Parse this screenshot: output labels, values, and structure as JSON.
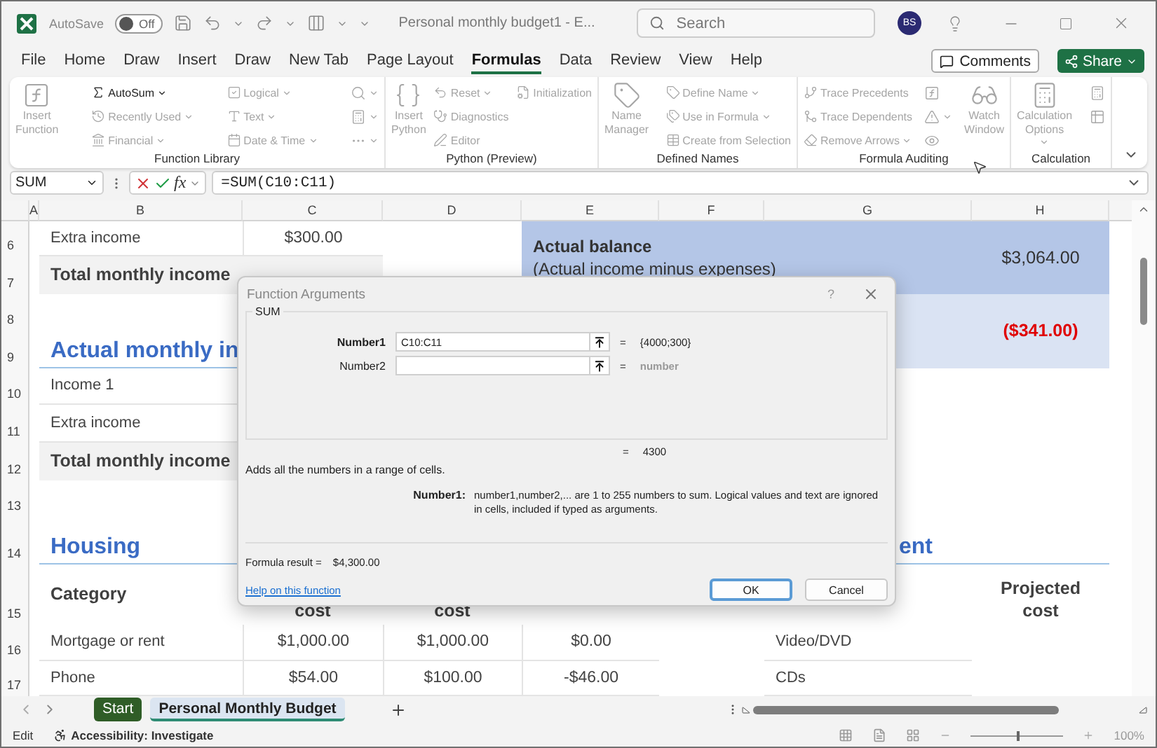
{
  "title_bar": {
    "autosave_label": "AutoSave",
    "autosave": {
      "on": false,
      "state_label": "Off"
    },
    "document_title": "Personal monthly budget1  -  E...",
    "search": {
      "placeholder": "Search"
    },
    "user_initials": "BS"
  },
  "menu_tabs": [
    {
      "label": "File",
      "selected": false
    },
    {
      "label": "Home",
      "selected": false
    },
    {
      "label": "Draw",
      "selected": false
    },
    {
      "label": "Insert",
      "selected": false
    },
    {
      "label": "Draw",
      "selected": false
    },
    {
      "label": "New Tab",
      "selected": false
    },
    {
      "label": "Page Layout",
      "selected": false
    },
    {
      "label": "Formulas",
      "selected": true
    },
    {
      "label": "Data",
      "selected": false
    },
    {
      "label": "Review",
      "selected": false
    },
    {
      "label": "View",
      "selected": false
    },
    {
      "label": "Help",
      "selected": false
    }
  ],
  "comments_button": "Comments",
  "share_button": "Share",
  "ribbon": [
    {
      "label": "Function Library",
      "columns": [
        [
          {
            "kind": "large",
            "lines": [
              "Insert",
              "Function"
            ],
            "disabled": true,
            "dropdown": false
          }
        ],
        [
          {
            "kind": "small",
            "label": "AutoSum",
            "disabled": false,
            "dropdown": true
          },
          {
            "kind": "small",
            "label": "Recently Used",
            "disabled": true,
            "dropdown": true
          },
          {
            "kind": "small",
            "label": "Financial",
            "disabled": true,
            "dropdown": true
          }
        ],
        [
          {
            "kind": "small",
            "label": "Logical",
            "disabled": true,
            "dropdown": true
          },
          {
            "kind": "small",
            "label": "Text",
            "disabled": true,
            "dropdown": true
          },
          {
            "kind": "small",
            "label": "Date & Time",
            "disabled": true,
            "dropdown": true
          }
        ],
        [
          {
            "kind": "icon",
            "disabled": true,
            "dropdown": true
          },
          {
            "kind": "icon",
            "disabled": true,
            "dropdown": true
          },
          {
            "kind": "icon",
            "disabled": true,
            "dropdown": true
          }
        ]
      ]
    },
    {
      "label": "Python (Preview)",
      "columns": [
        [
          {
            "kind": "large",
            "lines": [
              "Insert",
              "Python"
            ],
            "disabled": true,
            "dropdown": false
          }
        ],
        [
          {
            "kind": "small",
            "label": "Reset",
            "disabled": true,
            "dropdown": true
          },
          {
            "kind": "small",
            "label": "Diagnostics",
            "disabled": true,
            "dropdown": false
          },
          {
            "kind": "small",
            "label": "Editor",
            "disabled": true,
            "dropdown": false
          }
        ],
        [
          {
            "kind": "small",
            "label": "Initialization",
            "disabled": true,
            "dropdown": false
          }
        ]
      ]
    },
    {
      "label": "Defined Names",
      "columns": [
        [
          {
            "kind": "large",
            "lines": [
              "Name",
              "Manager"
            ],
            "disabled": true,
            "dropdown": false
          }
        ],
        [
          {
            "kind": "small",
            "label": "Define Name",
            "disabled": true,
            "dropdown": true
          },
          {
            "kind": "small",
            "label": "Use in Formula",
            "disabled": true,
            "dropdown": true
          },
          {
            "kind": "small",
            "label": "Create from Selection",
            "disabled": true,
            "dropdown": false
          }
        ]
      ]
    },
    {
      "label": "Formula Auditing",
      "columns": [
        [
          {
            "kind": "small",
            "label": "Trace Precedents",
            "disabled": true,
            "dropdown": false
          },
          {
            "kind": "small",
            "label": "Trace Dependents",
            "disabled": true,
            "dropdown": false
          },
          {
            "kind": "small",
            "label": "Remove Arrows",
            "disabled": true,
            "dropdown": true
          }
        ],
        [
          {
            "kind": "icon",
            "disabled": true,
            "dropdown": false
          },
          {
            "kind": "icon",
            "disabled": true,
            "dropdown": true
          },
          {
            "kind": "icon",
            "disabled": true,
            "dropdown": false
          }
        ],
        [
          {
            "kind": "large",
            "lines": [
              "Watch",
              "Window"
            ],
            "disabled": true,
            "dropdown": false
          }
        ]
      ]
    },
    {
      "label": "Calculation",
      "columns": [
        [
          {
            "kind": "large",
            "lines": [
              "Calculation",
              "Options"
            ],
            "disabled": true,
            "dropdown": true
          }
        ],
        [
          {
            "kind": "icon",
            "disabled": true,
            "dropdown": false
          },
          {
            "kind": "icon",
            "disabled": true,
            "dropdown": false
          }
        ]
      ]
    }
  ],
  "formula_bar": {
    "name_box": "SUM",
    "fx_label": "fx",
    "formula": "=SUM(C10:C11)"
  },
  "sheet": {
    "columns": [
      "A",
      "B",
      "C",
      "D",
      "E",
      "F",
      "G",
      "H"
    ],
    "rows": [
      {
        "number": "6",
        "cells": {
          "B": {
            "kind": "label",
            "text": "Extra income"
          },
          "C": {
            "kind": "money",
            "text": "$300.00"
          }
        }
      },
      {
        "number": "7",
        "cells": {
          "B": {
            "kind": "total",
            "text": "Total monthly income"
          },
          "C": {
            "kind": "total_fill"
          }
        }
      },
      {
        "number": "8"
      },
      {
        "number": "9",
        "cells": {
          "B": {
            "kind": "heading",
            "text": "Actual monthly in"
          }
        }
      },
      {
        "number": "10",
        "cells": {
          "B": {
            "kind": "label",
            "text": "Income 1"
          }
        }
      },
      {
        "number": "11",
        "cells": {
          "B": {
            "kind": "label",
            "text": "Extra income"
          }
        }
      },
      {
        "number": "12",
        "cells": {
          "B": {
            "kind": "total",
            "text": "Total monthly income"
          }
        }
      },
      {
        "number": "13"
      },
      {
        "number": "14",
        "cells": {
          "B": {
            "kind": "heading",
            "text": "Housing"
          },
          "G": {
            "kind": "heading",
            "text": "ent"
          }
        }
      },
      {
        "number": "15",
        "cells": {
          "B": {
            "kind": "category",
            "text": "Category"
          },
          "C": {
            "kind": "column_header",
            "text": "cost"
          },
          "D": {
            "kind": "column_header",
            "text": "cost"
          },
          "H": {
            "kind": "column_header",
            "text": "Projected cost"
          }
        }
      },
      {
        "number": "16",
        "cells": {
          "B": {
            "kind": "label",
            "text": "Mortgage or rent"
          },
          "C": {
            "kind": "money",
            "text": "$1,000.00"
          },
          "D": {
            "kind": "money",
            "text": "$1,000.00"
          },
          "E": {
            "kind": "money",
            "text": "$0.00"
          },
          "G": {
            "kind": "label",
            "text": "Video/DVD"
          }
        }
      },
      {
        "number": "17",
        "cells": {
          "B": {
            "kind": "label",
            "text": "Phone"
          },
          "C": {
            "kind": "money",
            "text": "$54.00"
          },
          "D": {
            "kind": "money",
            "text": "$100.00"
          },
          "E": {
            "kind": "money",
            "text": "-$46.00"
          },
          "G": {
            "kind": "label",
            "text": "CDs"
          }
        }
      }
    ],
    "balances": [
      {
        "kind": "actual",
        "title": "Actual balance",
        "subtitle": "(Actual income minus expenses)",
        "value": "$3,064.00",
        "negative": false
      },
      {
        "kind": "projected",
        "value": "($341.00)",
        "negative": true
      }
    ]
  },
  "dialog": {
    "title": "Function Arguments",
    "help_button": "?",
    "function_name": "SUM",
    "arguments": [
      {
        "label": "Number1",
        "value": "C10:C11",
        "equals": "=",
        "result": "{4000;300}",
        "active": true
      },
      {
        "label": "Number2",
        "equals": "=",
        "result": "number",
        "active": false
      }
    ],
    "total": {
      "equals": "=",
      "value": "4300"
    },
    "description": "Adds all the numbers in a range of cells.",
    "argument_help": {
      "label": "Number1:",
      "text": "number1,number2,... are 1 to 255 numbers to sum. Logical values and text are ignored in cells, included if typed as arguments."
    },
    "formula_result": {
      "label": "Formula result =",
      "value": "$4,300.00"
    },
    "help_link": "Help on this function",
    "buttons": [
      {
        "label": "OK",
        "default": true
      },
      {
        "label": "Cancel",
        "default": false
      }
    ]
  },
  "sheet_tabs": [
    {
      "label": "Start",
      "selected": false,
      "color": "#2f5d27"
    },
    {
      "label": "Personal Monthly Budget",
      "selected": true
    }
  ],
  "status_bar": {
    "mode": "Edit",
    "accessibility": "Accessibility: Investigate",
    "zoom": {
      "level": 0.5,
      "reading": "100%"
    }
  }
}
